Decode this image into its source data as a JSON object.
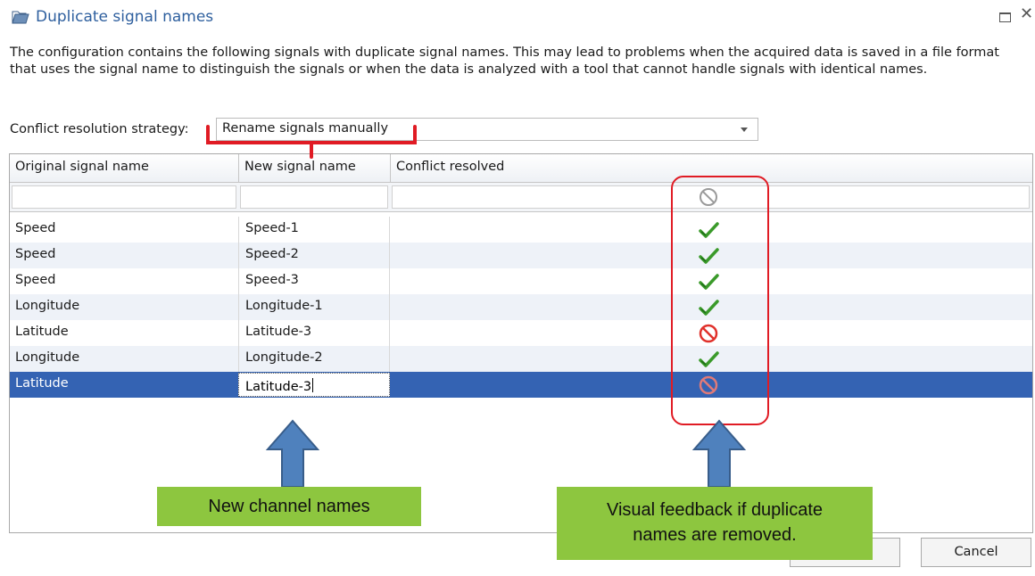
{
  "window": {
    "title": "Duplicate signal names",
    "icon": "folder-icon"
  },
  "description": "The configuration contains the following signals with duplicate signal names. This may lead to problems when the acquired data is saved in a file format that uses the signal name to distinguish the signals or when the data is analyzed with a tool that cannot handle signals with identical names.",
  "strategy": {
    "label": "Conflict resolution strategy:",
    "value": "Rename signals manually"
  },
  "grid": {
    "columns": [
      "Original signal name",
      "New signal name",
      "Conflict resolved"
    ],
    "filter_icon": "not-allowed-icon",
    "rows": [
      {
        "original": "Speed",
        "new": "Speed-1",
        "resolved": true
      },
      {
        "original": "Speed",
        "new": "Speed-2",
        "resolved": true
      },
      {
        "original": "Speed",
        "new": "Speed-3",
        "resolved": true
      },
      {
        "original": "Longitude",
        "new": "Longitude-1",
        "resolved": true
      },
      {
        "original": "Latitude",
        "new": "Latitude-3",
        "resolved": false
      },
      {
        "original": "Longitude",
        "new": "Longitude-2",
        "resolved": true
      },
      {
        "original": "Latitude",
        "new": "Latitude-3",
        "resolved": false,
        "selected": true
      }
    ]
  },
  "annotations": {
    "left": "New channel names",
    "right_line1": "Visual feedback if duplicate",
    "right_line2": "names are removed."
  },
  "buttons": {
    "cancel": "Cancel"
  },
  "colors": {
    "title": "#2e5f9e",
    "selection": "#3463b3",
    "callout": "#8dc63f",
    "highlight": "#e01b24",
    "arrow": "#4f81bd"
  }
}
